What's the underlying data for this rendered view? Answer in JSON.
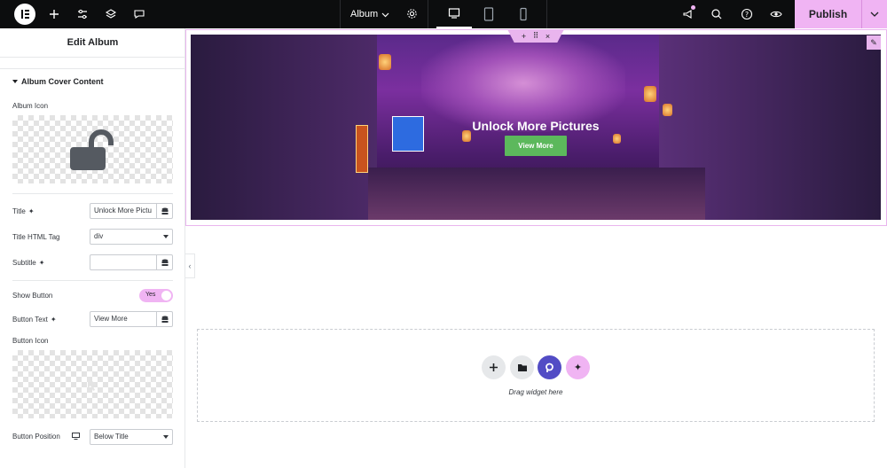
{
  "topbar": {
    "document_name": "Album",
    "publish_label": "Publish",
    "icons": [
      "elementor-logo-icon",
      "plus-icon",
      "sliders-icon",
      "layers-icon",
      "comment-icon",
      "settings-gear-icon",
      "desktop-icon",
      "tablet-icon",
      "mobile-icon",
      "megaphone-icon",
      "search-icon",
      "help-icon",
      "eye-icon",
      "chevron-down-icon"
    ],
    "accent": "#f0b4f3"
  },
  "panel": {
    "title": "Edit Album",
    "section": "Album Cover Content",
    "album_icon_label": "Album Icon",
    "title_label": "Title",
    "title_value": "Unlock More Pictu",
    "title_tag_label": "Title HTML Tag",
    "title_tag_value": "div",
    "subtitle_label": "Subtitle",
    "subtitle_value": "",
    "show_button_label": "Show Button",
    "show_button_value": "Yes",
    "button_text_label": "Button Text",
    "button_text_value": "View More",
    "button_icon_label": "Button Icon",
    "button_position_label": "Button Position",
    "button_position_value": "Below Title"
  },
  "canvas": {
    "hero_title": "Unlock More Pictures",
    "hero_button": "View More",
    "drop_text": "Drag widget here",
    "button_color": "#5cb85c"
  }
}
